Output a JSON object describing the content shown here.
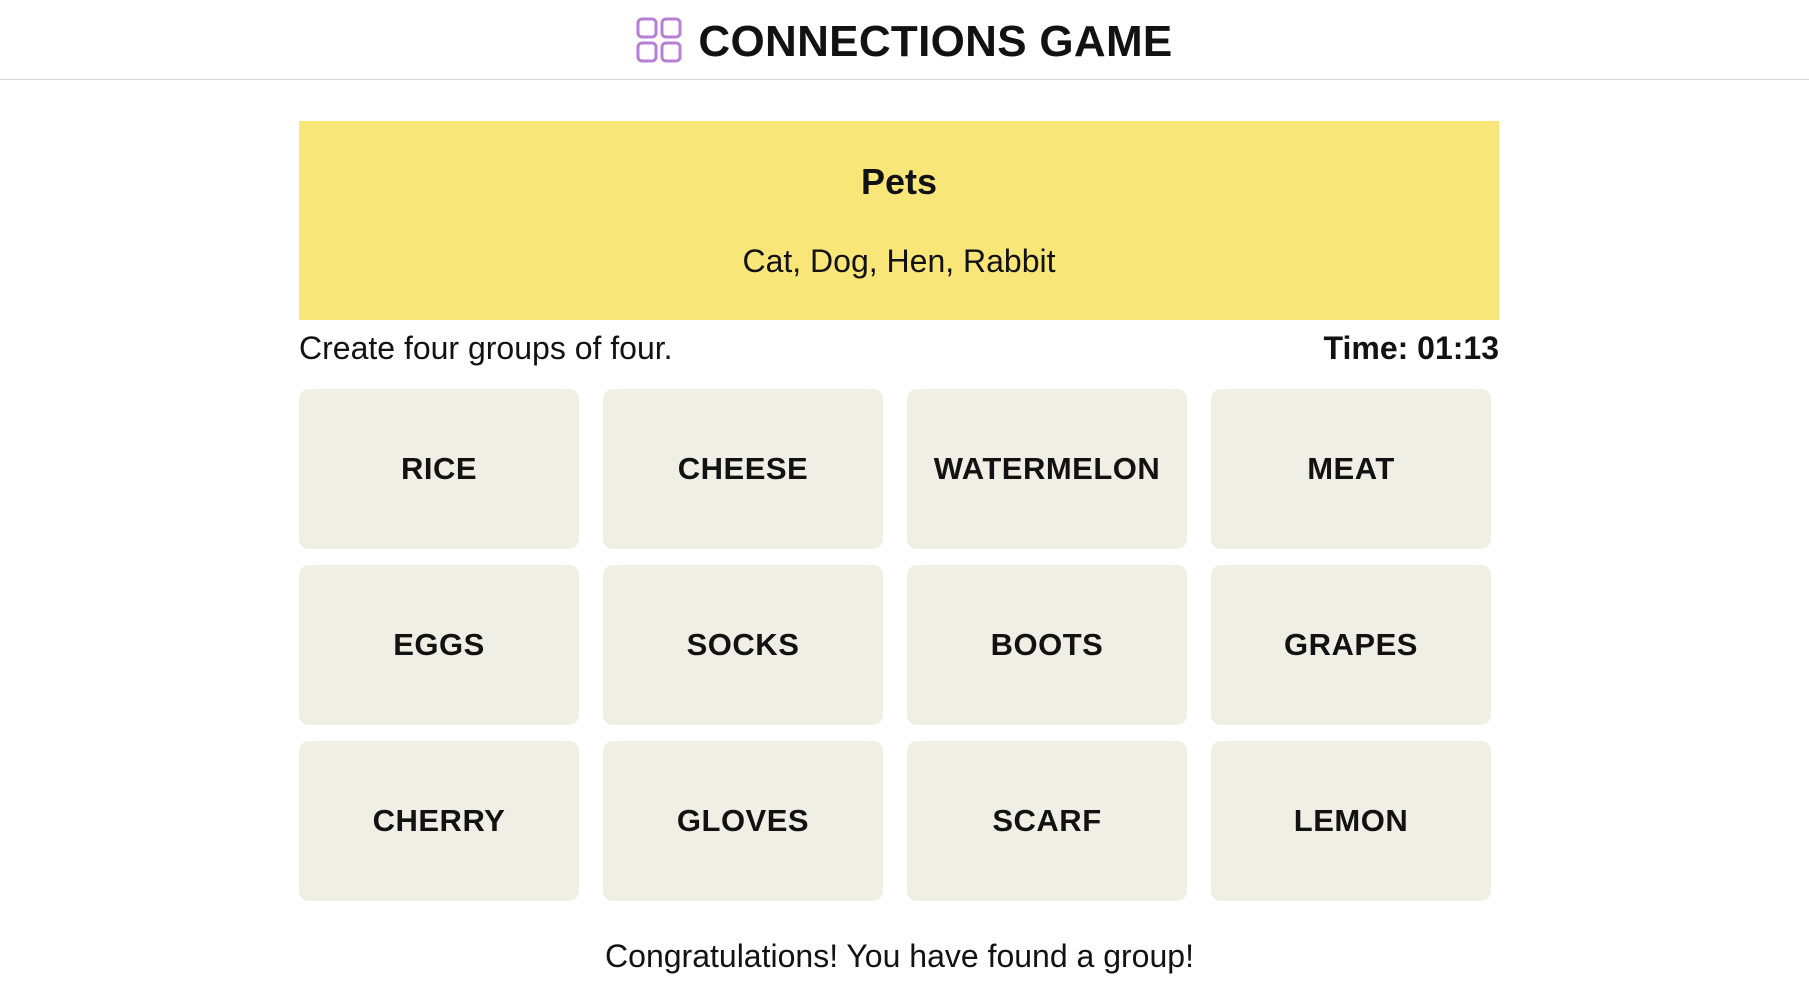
{
  "header": {
    "logo_icon": "grid-squares-icon",
    "logo_color": "#b57fd6",
    "title": "CONNECTIONS GAME"
  },
  "solved_groups": [
    {
      "category": "Pets",
      "members": "Cat, Dog, Hen, Rabbit",
      "color": "#f9e679"
    }
  ],
  "instructions": "Create four groups of four.",
  "timer": "Time: 01:13",
  "tiles": [
    "RICE",
    "CHEESE",
    "WATERMELON",
    "MEAT",
    "EGGS",
    "SOCKS",
    "BOOTS",
    "GRAPES",
    "CHERRY",
    "GLOVES",
    "SCARF",
    "LEMON"
  ],
  "message": "Congratulations! You have found a group!",
  "colors": {
    "tile_bg": "#efefe6",
    "text": "#121212"
  }
}
